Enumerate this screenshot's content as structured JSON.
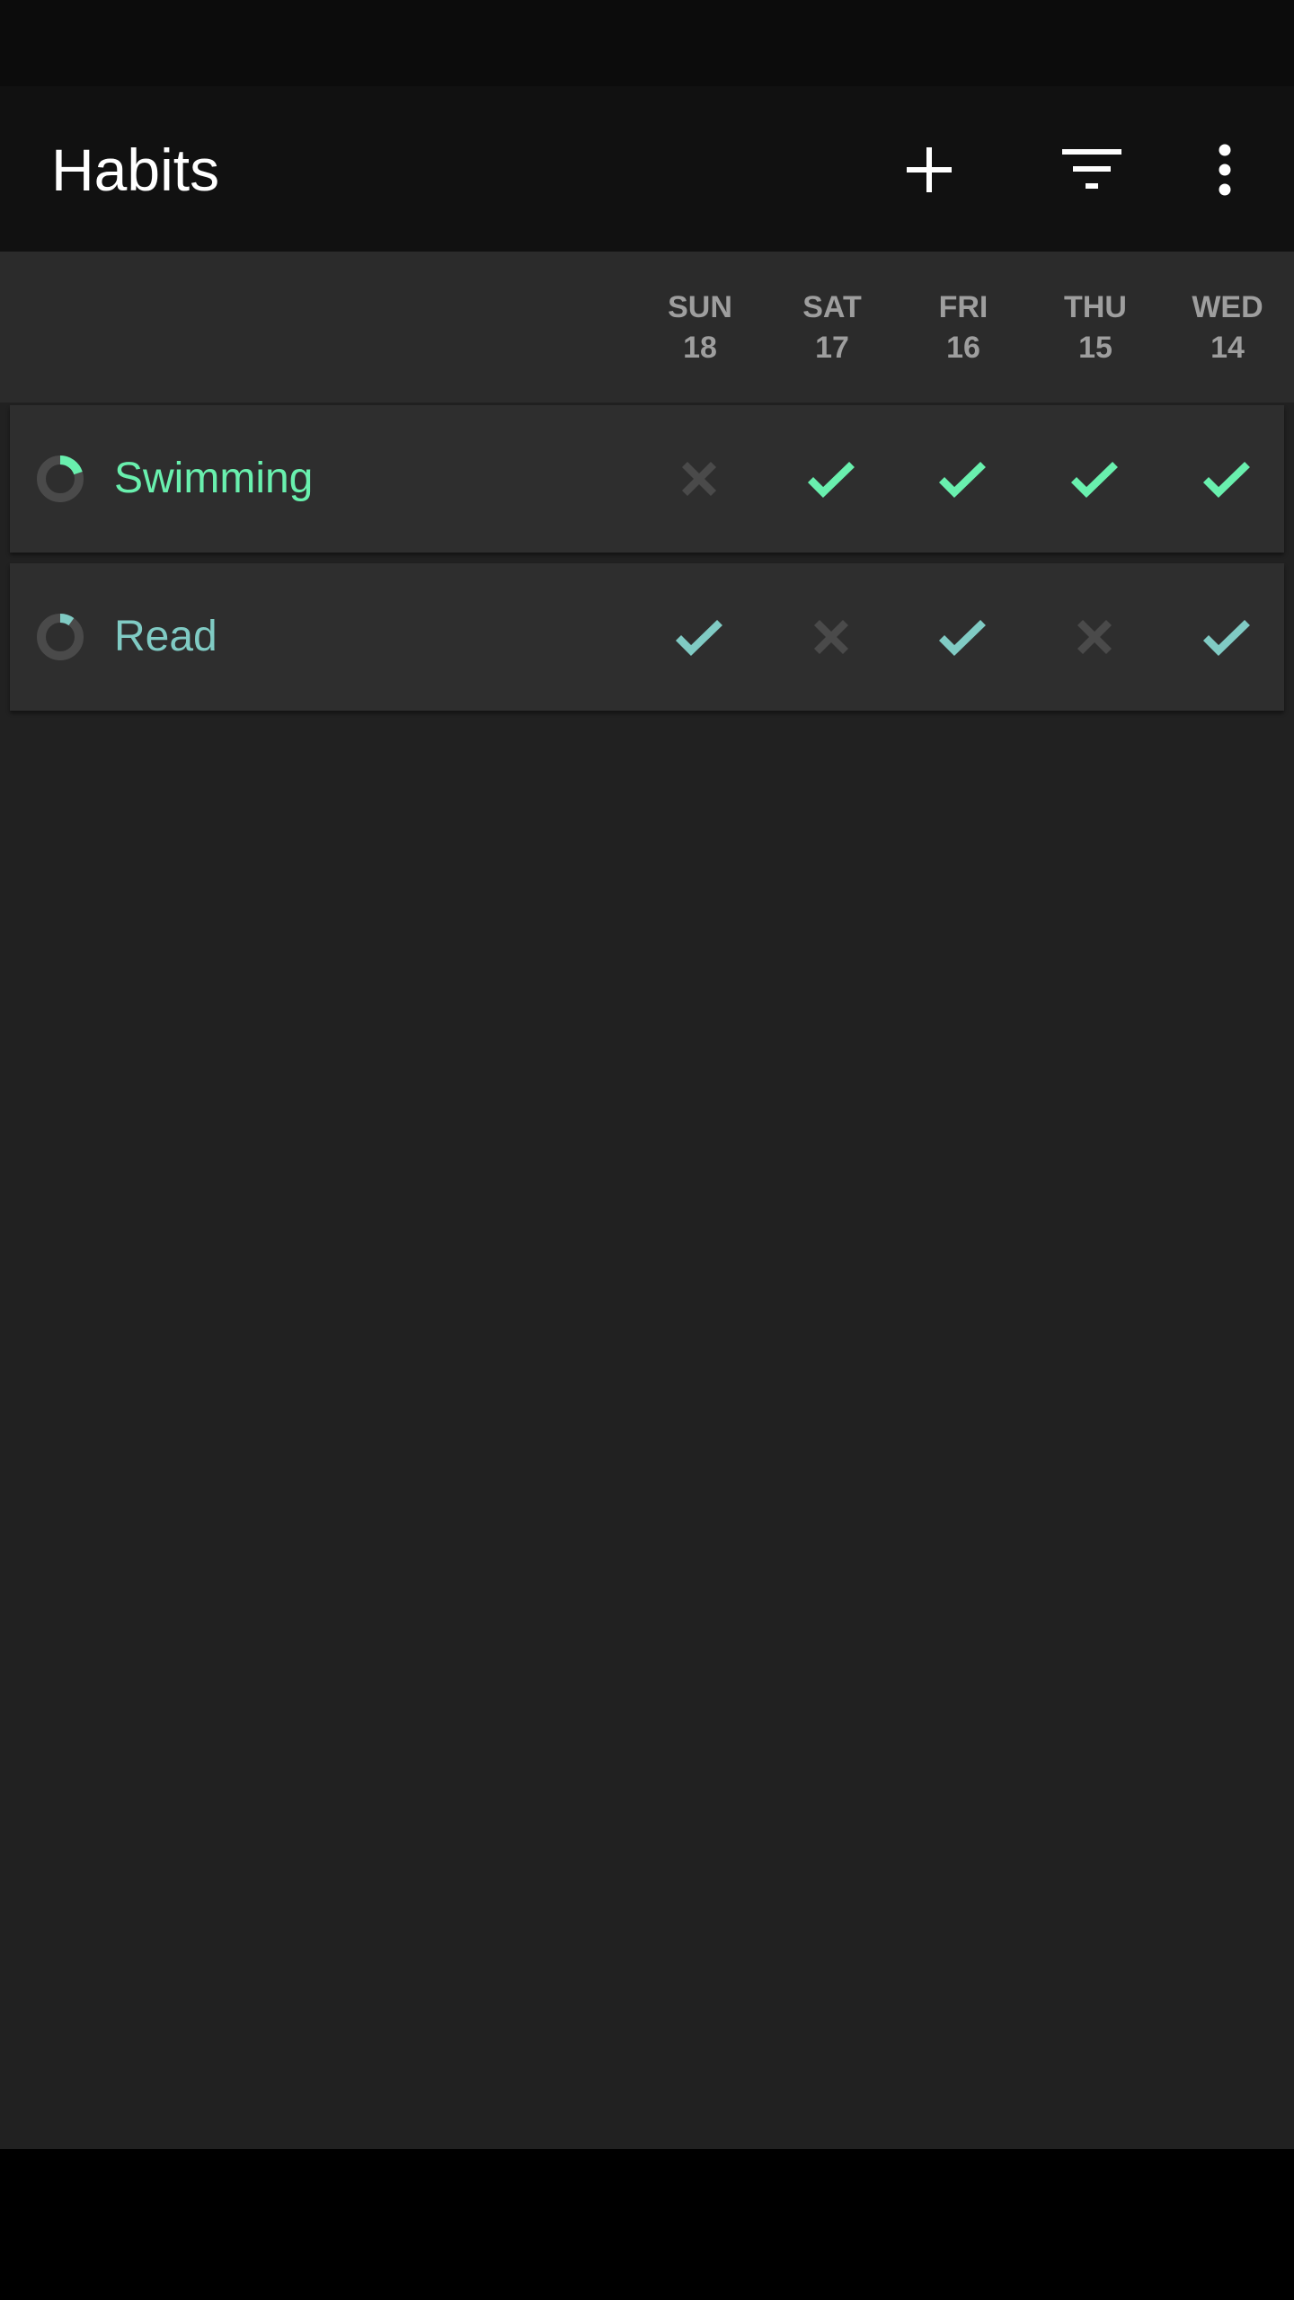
{
  "toolbar": {
    "title": "Habits",
    "add_icon": "plus-icon",
    "filter_icon": "filter-icon",
    "overflow_icon": "more-vert-icon"
  },
  "days": [
    {
      "weekday": "SUN",
      "date": "18"
    },
    {
      "weekday": "SAT",
      "date": "17"
    },
    {
      "weekday": "FRI",
      "date": "16"
    },
    {
      "weekday": "THU",
      "date": "15"
    },
    {
      "weekday": "WED",
      "date": "14"
    }
  ],
  "habits": [
    {
      "name": "Swimming",
      "color": "#69f0ae",
      "score": 0.2,
      "checks": [
        false,
        true,
        true,
        true,
        true
      ]
    },
    {
      "name": "Read",
      "color": "#80cbc4",
      "score": 0.1,
      "checks": [
        true,
        false,
        true,
        false,
        true
      ]
    }
  ],
  "colors": {
    "background": "#212121",
    "toolbar": "#111111",
    "header": "#2b2b2b",
    "card": "#2e2e2e",
    "unchecked": "#4a4a4a",
    "day_label": "#9e9e9e"
  }
}
